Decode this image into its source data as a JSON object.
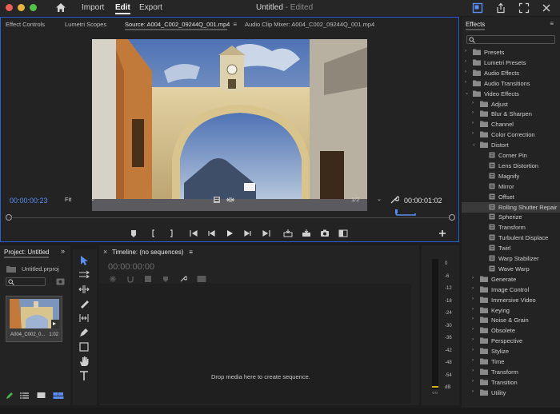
{
  "titlebar": {
    "workspaces": [
      "Import",
      "Edit",
      "Export"
    ],
    "active_workspace": "Edit",
    "title": "Untitled",
    "title_suffix": " - Edited"
  },
  "source_monitor": {
    "tabs": [
      "Effect Controls",
      "Lumetri Scopes",
      "Source: A004_C002_09244Q_001.mp4",
      "Audio Clip Mixer: A004_C002_09244Q_001.mp4"
    ],
    "active_tab": 2,
    "tab_menu_icon": "≡",
    "timecode_in": "00:00:00:23",
    "timecode_out": "00:00:01:02",
    "zoom": "Fit",
    "resolution": "1/2",
    "playhead_progress": 0.88
  },
  "project": {
    "title": "Project: Untitled",
    "file_name": "Untitled.prproj",
    "clip": {
      "name": "A004_C002_0...",
      "duration": "1:02"
    }
  },
  "timeline": {
    "title": "Timeline: (no sequences)",
    "close_glyph": "×",
    "menu_icon": "≡",
    "timecode": "00:00:00:00",
    "drop_text": "Drop media here to create sequence."
  },
  "meter": {
    "labels": [
      "0",
      "-6",
      "-12",
      "-18",
      "-24",
      "-30",
      "-36",
      "-42",
      "-48",
      "-54",
      "dB"
    ]
  },
  "effects": {
    "title": "Effects",
    "menu_icon": "≡",
    "items": [
      {
        "label": "Presets",
        "level": 0,
        "open": false,
        "folder": true
      },
      {
        "label": "Lumetri Presets",
        "level": 0,
        "open": false,
        "folder": true
      },
      {
        "label": "Audio Effects",
        "level": 0,
        "open": false,
        "folder": true
      },
      {
        "label": "Audio Transitions",
        "level": 0,
        "open": false,
        "folder": true
      },
      {
        "label": "Video Effects",
        "level": 0,
        "open": true,
        "folder": true
      },
      {
        "label": "Adjust",
        "level": 1,
        "open": false,
        "folder": true
      },
      {
        "label": "Blur & Sharpen",
        "level": 1,
        "open": false,
        "folder": true
      },
      {
        "label": "Channel",
        "level": 1,
        "open": false,
        "folder": true
      },
      {
        "label": "Color Correction",
        "level": 1,
        "open": false,
        "folder": true
      },
      {
        "label": "Distort",
        "level": 1,
        "open": true,
        "folder": true
      },
      {
        "label": "Corner Pin",
        "level": 2,
        "folder": false
      },
      {
        "label": "Lens Distortion",
        "level": 2,
        "folder": false
      },
      {
        "label": "Magnify",
        "level": 2,
        "folder": false
      },
      {
        "label": "Mirror",
        "level": 2,
        "folder": false
      },
      {
        "label": "Offset",
        "level": 2,
        "folder": false
      },
      {
        "label": "Rolling Shutter Repair",
        "level": 2,
        "folder": false,
        "selected": true
      },
      {
        "label": "Spherize",
        "level": 2,
        "folder": false
      },
      {
        "label": "Transform",
        "level": 2,
        "folder": false
      },
      {
        "label": "Turbulent Displace",
        "level": 2,
        "folder": false
      },
      {
        "label": "Twirl",
        "level": 2,
        "folder": false
      },
      {
        "label": "Warp Stabilizer",
        "level": 2,
        "folder": false
      },
      {
        "label": "Wave Warp",
        "level": 2,
        "folder": false
      },
      {
        "label": "Generate",
        "level": 1,
        "open": false,
        "folder": true
      },
      {
        "label": "Image Control",
        "level": 1,
        "open": false,
        "folder": true
      },
      {
        "label": "Immersive Video",
        "level": 1,
        "open": false,
        "folder": true
      },
      {
        "label": "Keying",
        "level": 1,
        "open": false,
        "folder": true
      },
      {
        "label": "Noise & Grain",
        "level": 1,
        "open": false,
        "folder": true
      },
      {
        "label": "Obsolete",
        "level": 1,
        "open": false,
        "folder": true
      },
      {
        "label": "Perspective",
        "level": 1,
        "open": false,
        "folder": true
      },
      {
        "label": "Stylize",
        "level": 1,
        "open": false,
        "folder": true
      },
      {
        "label": "Time",
        "level": 1,
        "open": false,
        "folder": true
      },
      {
        "label": "Transform",
        "level": 1,
        "open": false,
        "folder": true
      },
      {
        "label": "Transition",
        "level": 1,
        "open": false,
        "folder": true
      },
      {
        "label": "Utility",
        "level": 1,
        "open": false,
        "folder": true
      }
    ]
  },
  "colors": {
    "accent_blue": "#2a5fd7",
    "timecode_blue": "#5a8ef5",
    "panel_bg": "#232323"
  }
}
